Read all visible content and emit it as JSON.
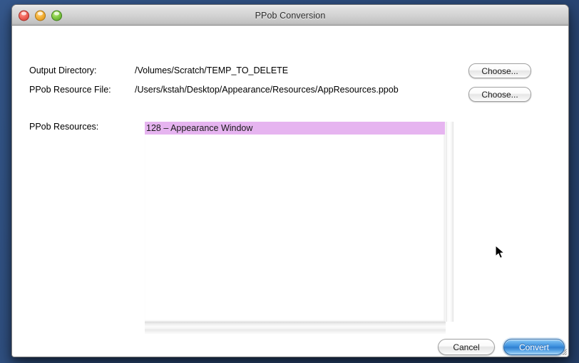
{
  "window": {
    "title": "PPob Conversion",
    "controls": {
      "close": "close-button",
      "minimize": "minimize-button",
      "zoom": "zoom-button"
    }
  },
  "form": {
    "fields": [
      {
        "label": "Output Directory:",
        "value": "/Volumes/Scratch/TEMP_TO_DELETE",
        "button": "Choose..."
      },
      {
        "label": "PPob Resource File:",
        "value": "/Users/kstah/Desktop/Appearance/Resources/AppResources.ppob",
        "button": "Choose..."
      }
    ],
    "list_label": "PPob Resources:"
  },
  "resources_list": {
    "items": [
      {
        "text": "128 – Appearance Window",
        "selected": true
      }
    ],
    "selection_color": "#e6b4f0",
    "selection_text_color": "#1a1a1a"
  },
  "footer": {
    "cancel_label": "Cancel",
    "convert_label": "Convert",
    "default_button": "Convert",
    "default_button_color": "#3c8fdd"
  },
  "colors": {
    "desktop": "#2d4c7c",
    "window_background": "#ffffff",
    "titlebar": "#d3d3d3",
    "close_light": "#f2685d",
    "minimize_light": "#f5b43c",
    "zoom_light": "#86cc45"
  }
}
